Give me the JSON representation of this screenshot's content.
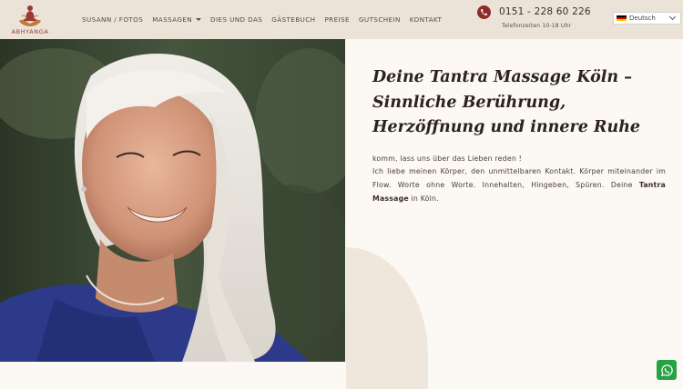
{
  "header": {
    "logo_text": "ABHYANGA",
    "nav": [
      {
        "label": "SUSANN / FOTOS"
      },
      {
        "label": "MASSAGEN"
      },
      {
        "label": "DIES UND DAS"
      },
      {
        "label": "GÄSTEBUCH"
      },
      {
        "label": "PREISE"
      },
      {
        "label": "GUTSCHEIN"
      },
      {
        "label": "KONTAKT"
      }
    ],
    "phone_number": "0151 - 228 60 226",
    "phone_hours": "Telefonzeiten 10-18 Uhr",
    "language": "Deutsch"
  },
  "main": {
    "title": "Deine Tantra Massage Köln – Sinnliche Berührung, Herzöffnung und innere Ruhe",
    "intro": "komm, lass uns über das Lieben reden !",
    "body_start": "Ich liebe meinen Körper, den unmittelbaren Kontakt. Körper miteinander im Flow. Worte ohne Worte. Innehalten, Hingeben, Spüren. Deine ",
    "body_bold": "Tantra Massage",
    "body_end": " in Köln."
  },
  "colors": {
    "header_bg": "#ebe2d8",
    "accent": "#8e2d28",
    "page_bg": "#fcf8f4",
    "whatsapp": "#25a244"
  },
  "icons": {
    "phone": "phone-icon",
    "whatsapp": "whatsapp-icon",
    "flag": "german-flag-icon"
  }
}
